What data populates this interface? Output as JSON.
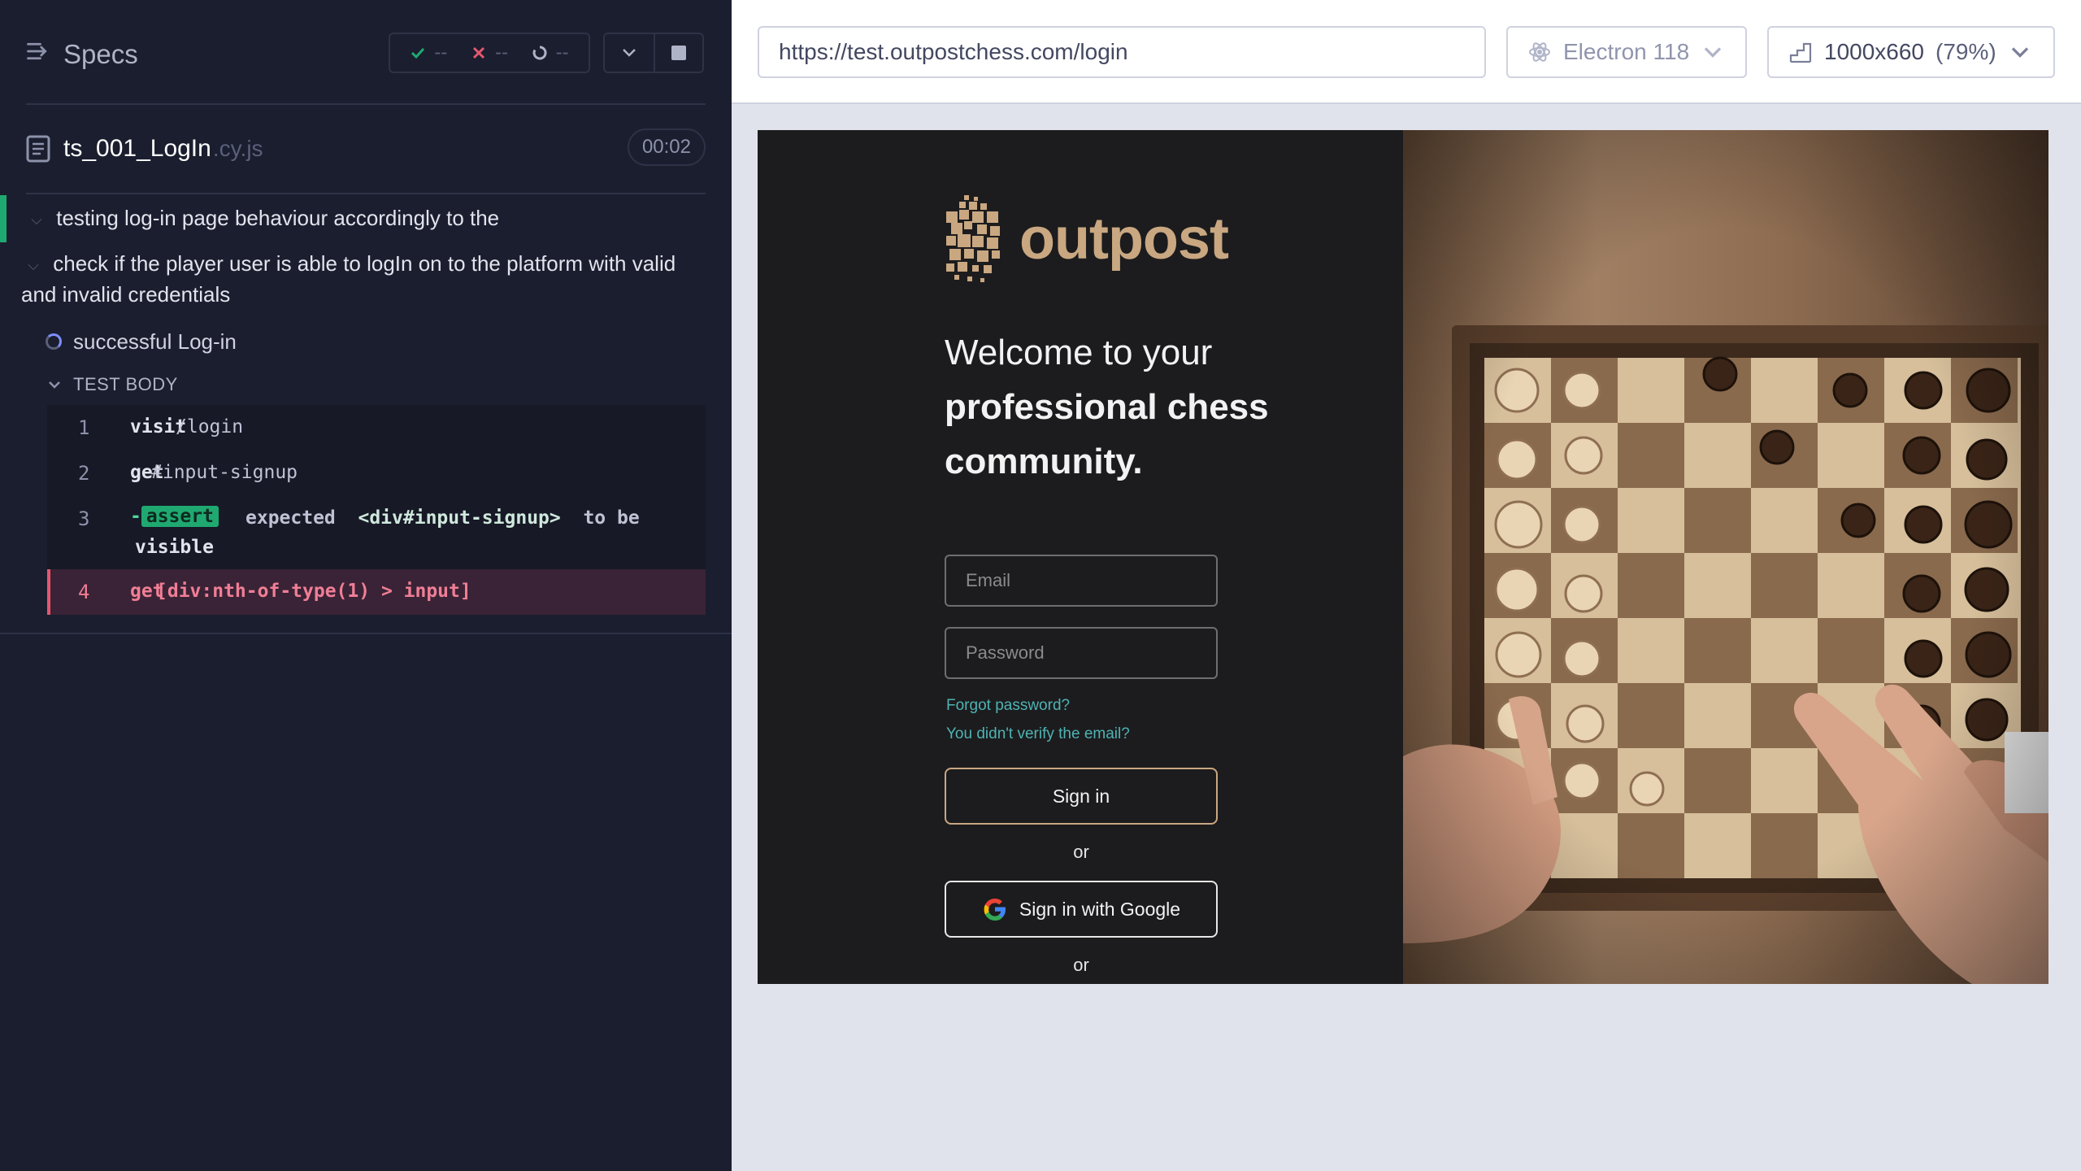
{
  "reporter": {
    "title": "Specs",
    "stats": {
      "passed": "--",
      "failed": "--",
      "pending": "--"
    },
    "spec": {
      "name": "ts_001_LogIn",
      "ext": ".cy.js",
      "duration": "00:02"
    },
    "suites": [
      "testing log-in page behaviour accordingly to the",
      "check if the player user is able to logIn on to the platform with valid and invalid credentials"
    ],
    "test": "successful Log-in",
    "section": "TEST BODY",
    "commands": [
      {
        "num": "1",
        "name": "visit",
        "message": "/login"
      },
      {
        "num": "2",
        "name": "get",
        "message": "#input-signup"
      },
      {
        "num": "3",
        "name": "-assert",
        "message_expected": "expected",
        "message_subject": "<div#input-signup>",
        "message_tail": "to be",
        "message_wrap": "visible"
      },
      {
        "num": "4",
        "name": "get",
        "message": "[div:nth-of-type(1) > input]"
      }
    ]
  },
  "aut": {
    "url": "https://test.outpostchess.com/login",
    "browser": "Electron 118",
    "viewport": "1000x660",
    "scale": "(79%)"
  },
  "page": {
    "brand": "outpost",
    "welcome_line1": "Welcome to your",
    "welcome_line2": "professional chess",
    "welcome_line3": "community.",
    "email_placeholder": "Email",
    "password_placeholder": "Password",
    "forgot_password": "Forgot password?",
    "verify_email": "You didn't verify the email?",
    "sign_in": "Sign in",
    "or": "or",
    "google_sign_in": "Sign in with Google"
  },
  "colors": {
    "reporter_bg": "#1b1e2e",
    "pass_green": "#1fa971",
    "fail_red": "#e45770",
    "brand_gold": "#c9a781",
    "link_teal": "#4fb3b3"
  }
}
